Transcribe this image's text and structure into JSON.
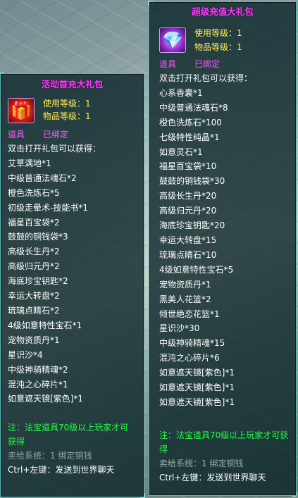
{
  "left": {
    "title": "活动首充大礼包",
    "icon": "red-gift-icon",
    "use_level": "使用等级：1",
    "item_level": "物品等级：1",
    "tabs": [
      "道具",
      "已绑定"
    ],
    "desc": "双击打开礼包可以获得：",
    "items": [
      "艾草满地*1",
      "中级普通法魂石*2",
      "橙色洗炼石*5",
      "初级走晕术-技能书*1",
      "福星百宝袋*2",
      "鼓鼓的铜钱袋*3",
      "高级长生丹*2",
      "高级归元丹*2",
      "海底珍宝钥匙*2",
      "幸运大转盘*2",
      "琉璃点睛石*2",
      "4级如意特性宝石*1",
      "宠物资质丹*1",
      "星识沙*4",
      "中级神骑精魂*2",
      "混沌之心碎片*1",
      "如意遮天镜[紫色]*1"
    ],
    "note": "注：法宝道具70级以上玩家才可获得",
    "sell": "卖给系统：1 绑定铜钱",
    "ctrl": "Ctrl+左键：发送到世界聊天"
  },
  "right": {
    "title": "超级充值大礼包",
    "icon": "purple-gift-icon",
    "use_level": "使用等级：1",
    "item_level": "物品等级：1",
    "tabs": [
      "道具",
      "已绑定"
    ],
    "desc": "双击打开礼包可以获得：",
    "items": [
      "心系香囊*1",
      "中级普通法魂石*8",
      "橙色洗炼石*100",
      "七级特性纯晶*1",
      "如意灵石*1",
      "福星百宝袋*10",
      "鼓鼓的铜钱袋*30",
      "高级长生丹*20",
      "高级归元丹*20",
      "海底珍宝钥匙*20",
      "幸运大转盘*15",
      "琉璃点睛石*10",
      "4级如意特性宝石*5",
      "宠物资质丹*1",
      "黑美人花篮*2",
      "倾世绝恋花篮*1",
      "星识沙*30",
      "中级神骑精魂*15",
      "混沌之心碎片*6",
      "如意遮天镜[紫色]*1",
      "如意遮天镜[紫色]*1",
      "如意遮天镜[紫色]*1"
    ],
    "note": "注：法宝道具70级以上玩家才可获得",
    "sell": "卖给系统：1 绑定铜钱",
    "ctrl": "Ctrl+左键：发送到世界聊天"
  }
}
